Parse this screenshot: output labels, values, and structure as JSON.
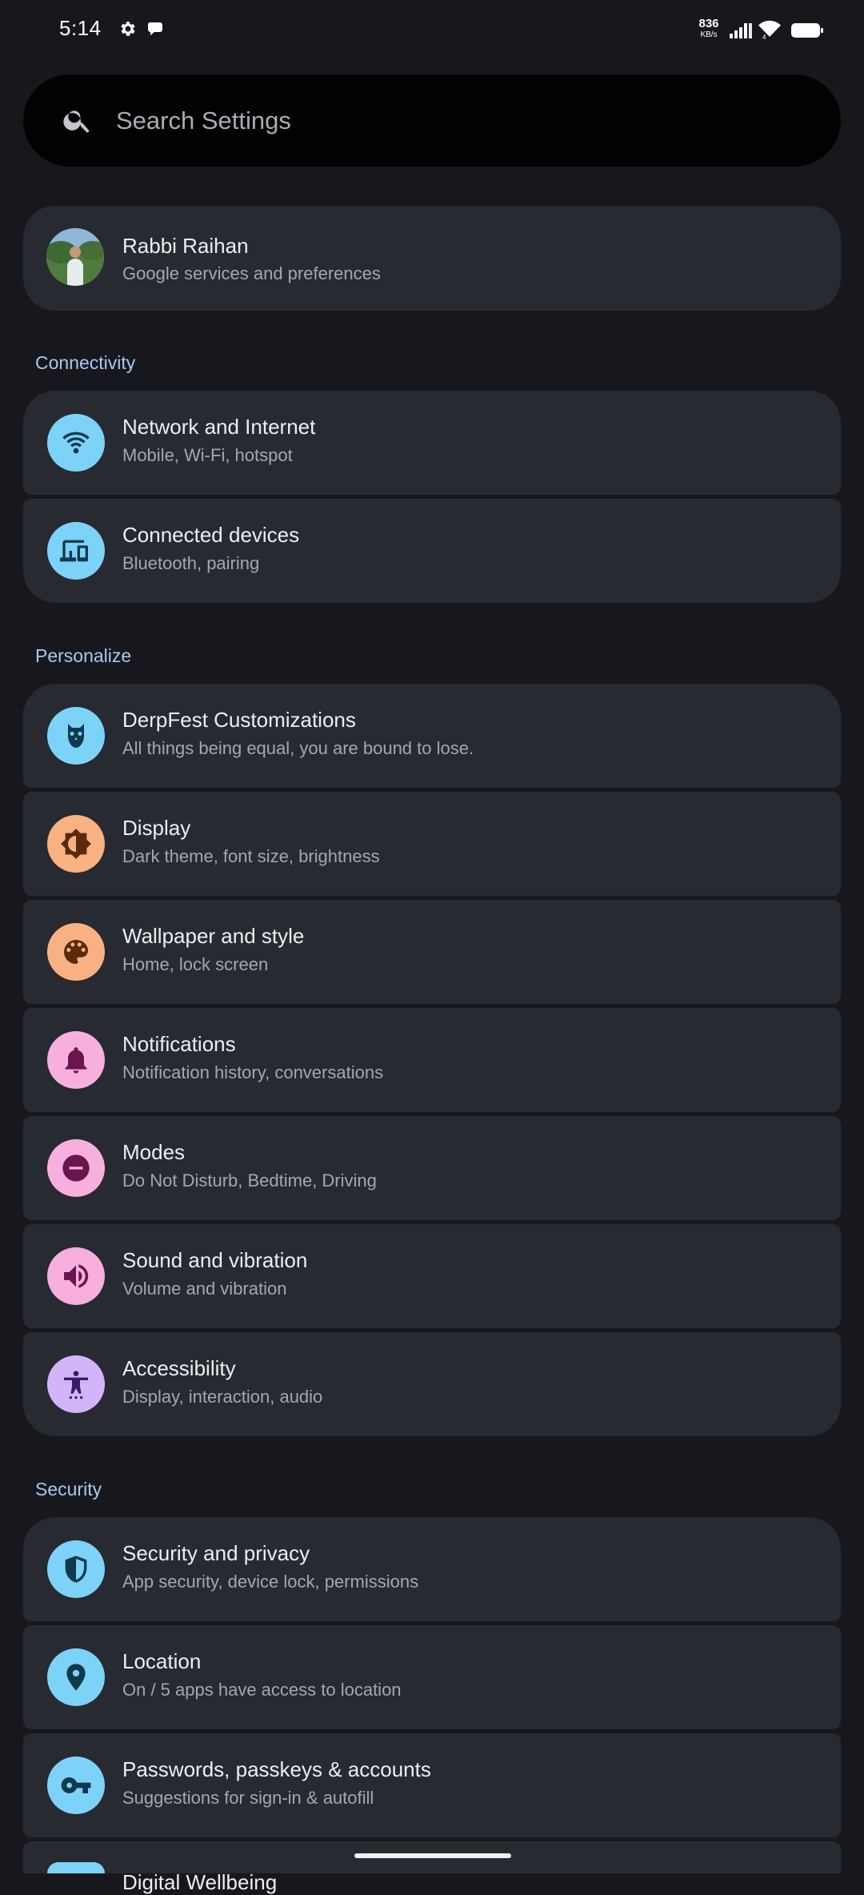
{
  "status_bar": {
    "time": "5:14",
    "netspeed_value": "836",
    "netspeed_unit": "KB/s"
  },
  "search": {
    "placeholder": "Search Settings"
  },
  "account": {
    "name": "Rabbi Raihan",
    "subtitle": "Google services and preferences"
  },
  "sections": {
    "connectivity": "Connectivity",
    "personalize": "Personalize",
    "security": "Security"
  },
  "items": {
    "network": {
      "title": "Network and Internet",
      "subtitle": "Mobile, Wi-Fi, hotspot",
      "icon": "wifi-icon"
    },
    "connected_devices": {
      "title": "Connected devices",
      "subtitle": "Bluetooth, pairing",
      "icon": "devices-icon"
    },
    "derpfest": {
      "title": "DerpFest Customizations",
      "subtitle": "All things being equal, you are bound to lose.",
      "icon": "owl-icon"
    },
    "display": {
      "title": "Display",
      "subtitle": "Dark theme, font size, brightness",
      "icon": "brightness-icon"
    },
    "wallpaper": {
      "title": "Wallpaper and style",
      "subtitle": "Home, lock screen",
      "icon": "palette-icon"
    },
    "notifications": {
      "title": "Notifications",
      "subtitle": "Notification history, conversations",
      "icon": "bell-icon"
    },
    "modes": {
      "title": "Modes",
      "subtitle": "Do Not Disturb, Bedtime, Driving",
      "icon": "do-not-disturb-icon"
    },
    "sound": {
      "title": "Sound and vibration",
      "subtitle": "Volume and vibration",
      "icon": "speaker-icon"
    },
    "accessibility": {
      "title": "Accessibility",
      "subtitle": "Display, interaction, audio",
      "icon": "accessibility-icon"
    },
    "security_privacy": {
      "title": "Security and privacy",
      "subtitle": "App security, device lock, permissions",
      "icon": "shield-icon"
    },
    "location": {
      "title": "Location",
      "subtitle": "On / 5 apps have access to location",
      "icon": "location-pin-icon"
    },
    "passwords": {
      "title": "Passwords, passkeys & accounts",
      "subtitle": "Suggestions for sign-in & autofill",
      "icon": "key-icon"
    },
    "peek": {
      "title": "Digital Wellbeing",
      "icon": "wellbeing-icon"
    }
  },
  "colors": {
    "background": "#16181d",
    "card": "#272a31",
    "section_title": "#a9c8ef",
    "blue_icon_bg": "#7dd3f7",
    "orange_icon_bg": "#f7b183",
    "pink_icon_bg": "#f7b0de",
    "purple_icon_bg": "#d4b4f8"
  }
}
